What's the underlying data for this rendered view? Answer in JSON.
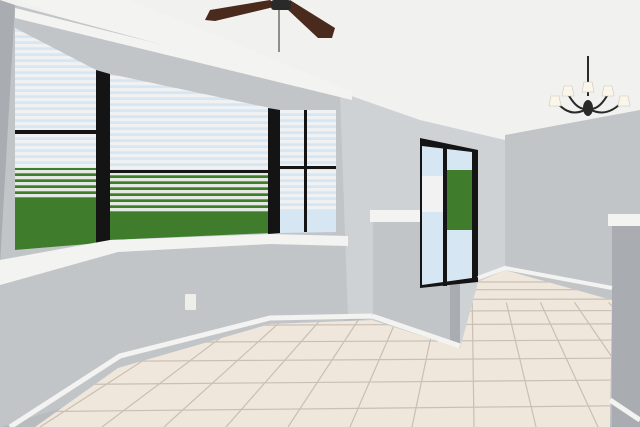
{
  "scene": {
    "colors": {
      "ceiling": "#f1f1f0",
      "wall": "#c2c5c8",
      "wall_light": "#cfd2d5",
      "wall_shadow": "#a9adb1",
      "trim": "#f3f3f1",
      "floor_tile": "#efe6dc",
      "grout": "#c9bfb4",
      "blind": "#f2f2f2",
      "window_frame": "#141414",
      "foliage": "#3f7d2c",
      "sky": "#d6e6f2",
      "fan_blade": "#4a2a1c",
      "fixture_metal": "#2a2a2a",
      "lamp_shade": "#fbf6ea",
      "outlet": "#efefe9"
    }
  }
}
